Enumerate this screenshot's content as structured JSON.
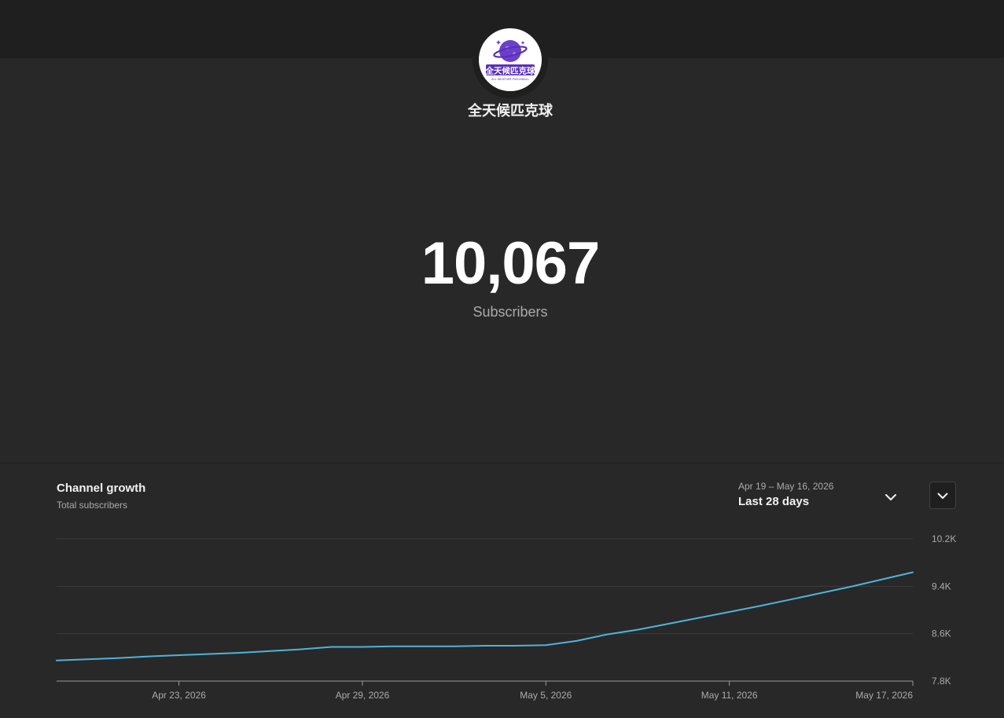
{
  "channel": {
    "name": "全天候匹克球",
    "logo_text": "全天候匹克球",
    "logo_subtext": "ALL WEATHER PICKLEBALL"
  },
  "counter": {
    "value": "10,067",
    "label": "Subscribers"
  },
  "panel": {
    "title": "Channel growth",
    "subtitle": "Total subscribers",
    "date_range": "Apr 19 – May 16, 2026",
    "range_label": "Last 28 days"
  },
  "icons": {
    "range_dropdown": "chevron-down-icon",
    "expand": "chevron-down-icon"
  },
  "colors": {
    "line": "#4fb3d9",
    "background": "#282828",
    "topbar": "#1f1f1f",
    "grid": "#3d3d3d",
    "tick_text": "#aaaaaa"
  },
  "chart_data": {
    "type": "line",
    "title": "Channel growth",
    "subtitle": "Total subscribers",
    "x_tick_labels": [
      "Apr 23, 2026",
      "Apr 29, 2026",
      "May 5, 2026",
      "May 11, 2026",
      "May 17, 2026"
    ],
    "y_tick_labels": [
      "10.2K",
      "9.4K",
      "8.6K",
      "7.8K"
    ],
    "y_ticks": [
      10200,
      9400,
      8600,
      7800
    ],
    "ylim": [
      7800,
      10200
    ],
    "xlim": [
      "2026-04-19",
      "2026-05-17"
    ],
    "grid": true,
    "y_axis_position": "right",
    "series": [
      {
        "x": [
          "2026-04-19",
          "2026-04-20",
          "2026-04-21",
          "2026-04-22",
          "2026-04-23",
          "2026-04-24",
          "2026-04-25",
          "2026-04-26",
          "2026-04-27",
          "2026-04-28",
          "2026-04-29",
          "2026-04-30",
          "2026-05-01",
          "2026-05-02",
          "2026-05-03",
          "2026-05-04",
          "2026-05-05",
          "2026-05-06",
          "2026-05-07",
          "2026-05-08",
          "2026-05-09",
          "2026-05-10",
          "2026-05-11",
          "2026-05-12",
          "2026-05-13",
          "2026-05-14",
          "2026-05-15",
          "2026-05-16",
          "2026-05-17"
        ],
        "values": [
          8147,
          8167,
          8187,
          8217,
          8237,
          8257,
          8277,
          8307,
          8337,
          8377,
          8377,
          8387,
          8387,
          8387,
          8397,
          8397,
          8407,
          8477,
          8587,
          8667,
          8767,
          8867,
          8967,
          9067,
          9177,
          9287,
          9397,
          9517,
          9637
        ]
      }
    ]
  }
}
